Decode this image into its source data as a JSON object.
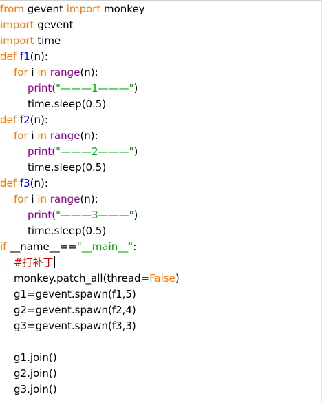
{
  "code": {
    "l1": {
      "kw1": "from",
      "t1": " gevent ",
      "kw2": "import",
      "t2": " monkey"
    },
    "l2": {
      "kw": "import",
      "t": " gevent"
    },
    "l3": {
      "kw": "import",
      "t": " time"
    },
    "f1": {
      "def": "def",
      "name": "f1",
      "params": "(n):",
      "for": "for",
      "var": " i ",
      "in": "in",
      "range": "range",
      "rangeArgs": "(n):",
      "print": "print",
      "open": "(",
      "str": "\"———1———\"",
      "close": ")",
      "sleep": "time.sleep(0.5)"
    },
    "f2": {
      "def": "def",
      "name": "f2",
      "params": "(n):",
      "for": "for",
      "var": " i ",
      "in": "in",
      "range": "range",
      "rangeArgs": "(n):",
      "print": "print",
      "open": "(",
      "str": "\"———2———\"",
      "close": ")",
      "sleep": "time.sleep(0.5)"
    },
    "f3": {
      "def": "def",
      "name": "f3",
      "params": "(n):",
      "for": "for",
      "var": " i ",
      "in": "in",
      "range": "range",
      "rangeArgs": "(n):",
      "print": "print",
      "open": "(",
      "str": "\"———3———\"",
      "close": ")",
      "sleep": "time.sleep(0.5)"
    },
    "main": {
      "kw": "if",
      "lhs": " __name__==",
      "str": "\"__main__\"",
      "colon": ":"
    },
    "comment": "#打补丁",
    "patch": {
      "pre": "monkey.patch_all(thread=",
      "val": "False",
      "post": ")"
    },
    "spawn": [
      "g1=gevent.spawn(f1,5)",
      "g2=gevent.spawn(f2,4)",
      "g3=gevent.spawn(f3,3)"
    ],
    "joins": [
      "g1.join()",
      "g2.join()",
      "g3.join()"
    ]
  }
}
